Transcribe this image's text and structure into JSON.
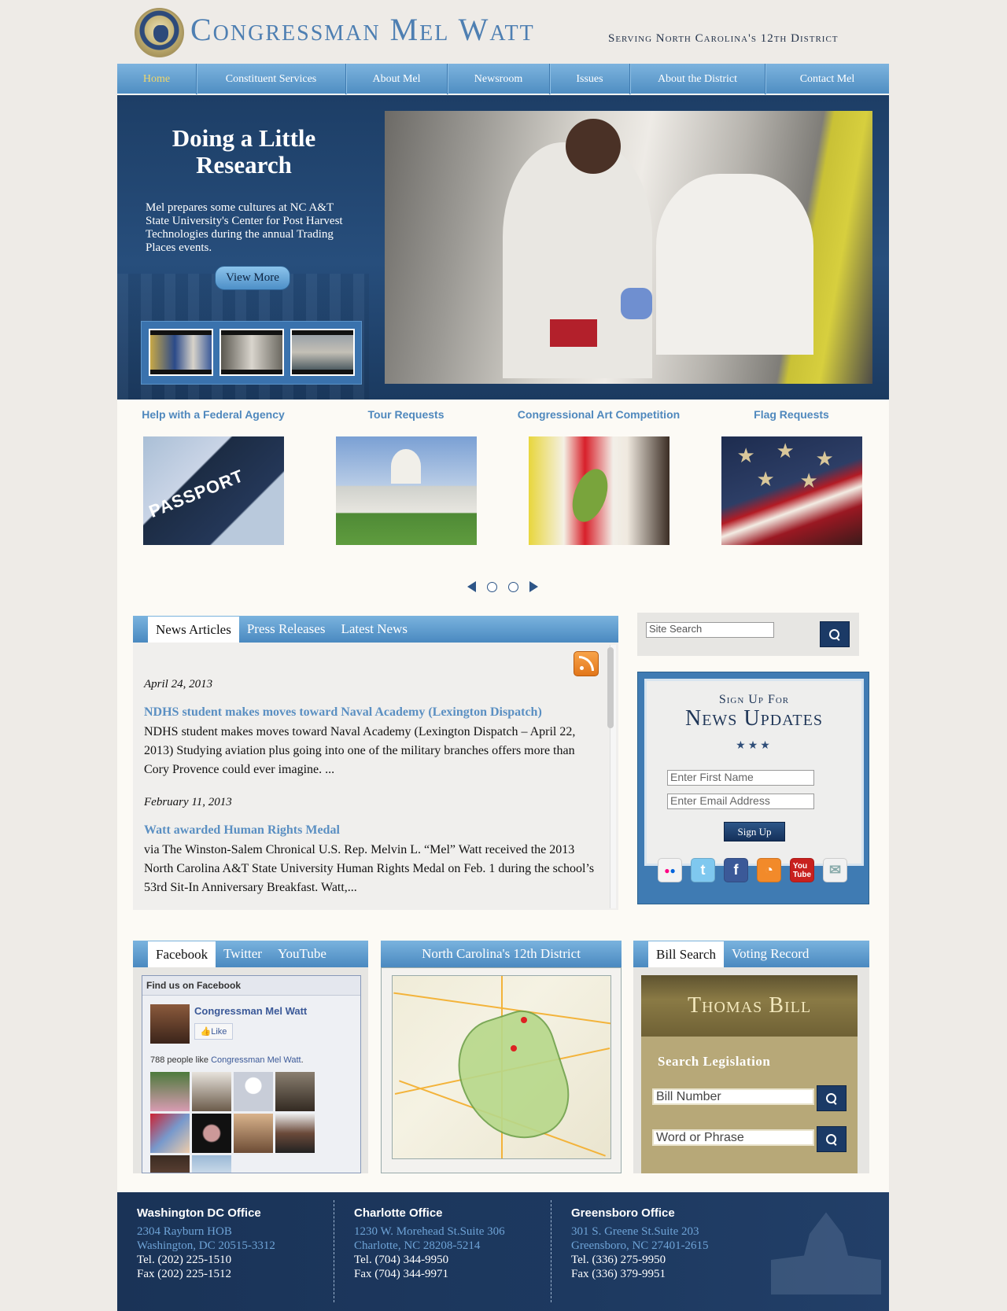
{
  "header": {
    "title": "Congressman Mel Watt",
    "subtitle": "Serving North Carolina's 12th District"
  },
  "nav": {
    "items": [
      {
        "label": "Home",
        "active": true
      },
      {
        "label": "Constituent Services"
      },
      {
        "label": "About Mel"
      },
      {
        "label": "Newsroom"
      },
      {
        "label": "Issues"
      },
      {
        "label": "About the District"
      },
      {
        "label": "Contact Mel"
      }
    ]
  },
  "hero": {
    "title": "Doing a Little Research",
    "text": "Mel prepares some cultures at NC A&T State University's Center for Post Harvest Technologies during the annual Trading Places events.",
    "button": "View More"
  },
  "services": [
    {
      "title": "Help with a Federal Agency",
      "image_text": "PASSPORT"
    },
    {
      "title": "Tour Requests"
    },
    {
      "title": "Congressional Art Competition"
    },
    {
      "title": "Flag Requests"
    }
  ],
  "news": {
    "tabs": [
      "News Articles",
      "Press Releases",
      "Latest News"
    ],
    "items": [
      {
        "date": "April 24, 2013",
        "title": "NDHS student makes moves toward Naval Academy (Lexington Dispatch)",
        "body": "NDHS student makes moves toward Naval Academy (Lexington Dispatch – April 22, 2013) Studying aviation plus going into one of the military branches offers more than Cory Provence could ever imagine. ..."
      },
      {
        "date": "February 11, 2013",
        "title": "Watt awarded Human Rights Medal",
        "body": "via The Winston-Salem Chronical U.S. Rep. Melvin L. “Mel” Watt received the 2013 North Carolina A&T State University Human Rights Medal on Feb. 1 during the school’s 53rd Sit-In Anniversary Breakfast. Watt,..."
      }
    ]
  },
  "search": {
    "placeholder": "Site Search"
  },
  "signup": {
    "small": "Sign Up For",
    "big": "News Updates",
    "stars": "★★★",
    "first_name_placeholder": "Enter First Name",
    "email_placeholder": "Enter Email Address",
    "button": "Sign Up",
    "social": [
      "flickr-icon",
      "twitter-icon",
      "facebook-icon",
      "rss-icon",
      "youtube-icon",
      "email-icon"
    ],
    "social_colors": [
      "#f3f3f3",
      "#7fc8ef",
      "#3b5998",
      "#f28a2a",
      "#c8201e",
      "#f1f1f1"
    ]
  },
  "social_panel": {
    "tabs": [
      "Facebook",
      "Twitter",
      "YouTube"
    ],
    "fb_header": "Find us on Facebook",
    "page_name": "Congressman Mel Watt",
    "like_label": "Like",
    "likes_prefix": "788 people like ",
    "likes_link": "Congressman Mel Watt",
    "likes_suffix": "."
  },
  "district_panel": {
    "title": "North Carolina's 12th District"
  },
  "bill_panel": {
    "tabs": [
      "Bill Search",
      "Voting Record"
    ],
    "banner": "Thomas Bill",
    "label": "Search Legislation",
    "bill_placeholder": "Bill Number",
    "phrase_placeholder": "Word or Phrase"
  },
  "footer": {
    "offices": [
      {
        "title": "Washington DC Office",
        "addr1": "2304 Rayburn HOB",
        "addr2": "Washington, DC 20515-3312",
        "tel": "Tel. (202) 225-1510",
        "fax": "Fax (202) 225-1512"
      },
      {
        "title": "Charlotte Office",
        "addr1": "1230 W. Morehead St.Suite 306",
        "addr2": "Charlotte, NC 28208-5214",
        "tel": "Tel. (704) 344-9950",
        "fax": "Fax (704) 344-9971"
      },
      {
        "title": "Greensboro Office",
        "addr1": "301 S. Greene St.Suite 203",
        "addr2": "Greensboro, NC 27401-2615",
        "tel": "Tel. (336) 275-9950",
        "fax": "Fax (336) 379-9951"
      }
    ]
  }
}
